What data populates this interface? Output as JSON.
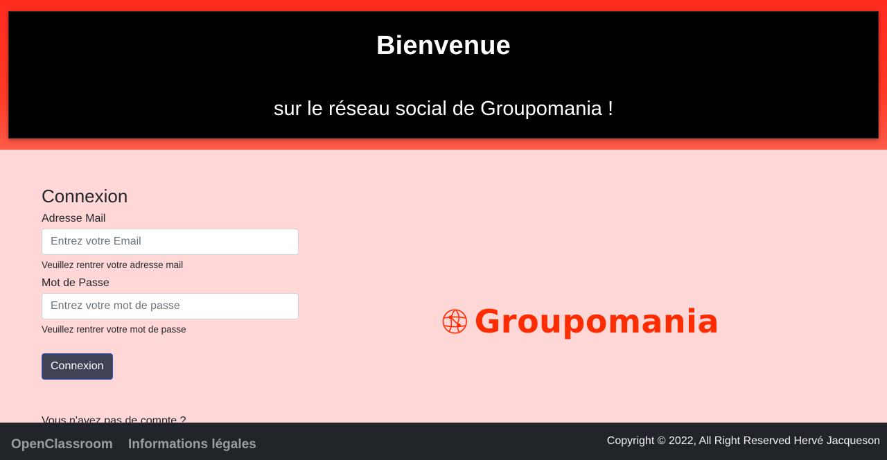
{
  "header": {
    "title": "Bienvenue",
    "subtitle": "sur le réseau social de Groupomania !"
  },
  "login": {
    "title": "Connexion",
    "email_label": "Adresse Mail",
    "email_placeholder": "Entrez votre Email",
    "email_value": "",
    "email_help": "Veuillez rentrer votre adresse mail",
    "password_label": "Mot de Passe",
    "password_placeholder": "Entrez votre mot de passe",
    "password_value": "",
    "password_help": "Veuillez rentrer votre mot de passe",
    "submit_label": "Connexion",
    "signup_prompt": "Vous n'avez pas de compte ?"
  },
  "logo": {
    "text": "Groupomania",
    "icon": "globe-icon",
    "color": "#fd2d01"
  },
  "footer": {
    "links": [
      "OpenClassroom",
      "Informations légales"
    ],
    "copyright": "Copyright © 2022, All Right Reserved Hervé Jacqueson"
  },
  "colors": {
    "header_band": "#ff2a1f",
    "page_background": "#ffd7d7",
    "footer_background": "#212529",
    "button_background": "#3e4456"
  }
}
